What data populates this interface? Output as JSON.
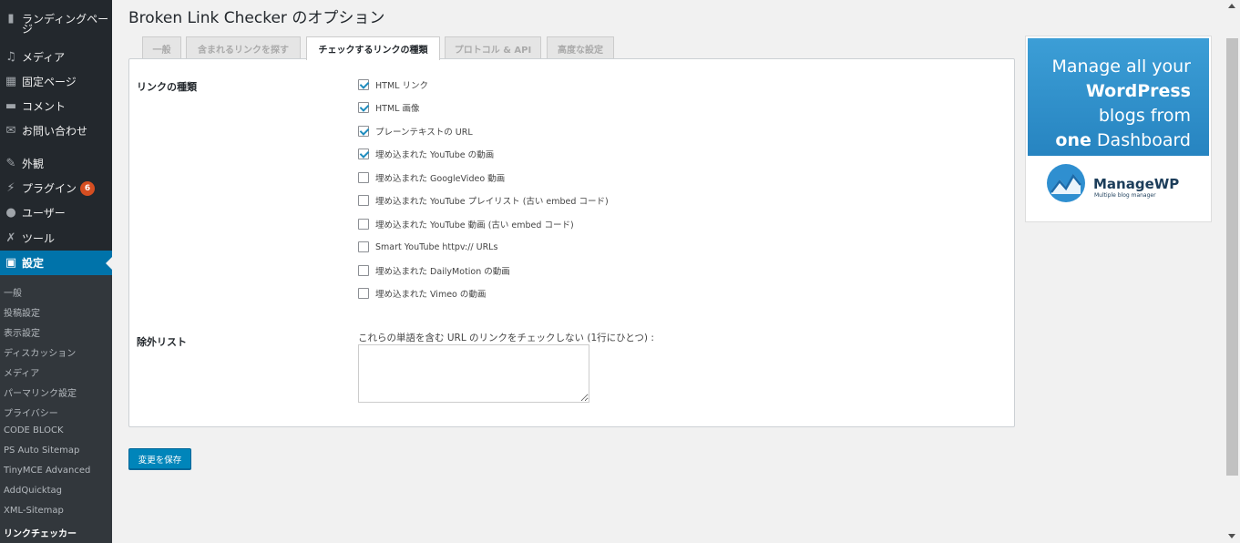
{
  "sidebar": {
    "items": [
      {
        "icon": "pages-icon",
        "glyph": "▮",
        "label": "ランディングペー"
      },
      {
        "icon": "media-icon",
        "glyph": "♫",
        "label": "メディア"
      },
      {
        "icon": "page-icon",
        "glyph": "▦",
        "label": "固定ページ"
      },
      {
        "icon": "comment-icon",
        "glyph": "▬",
        "label": "コメント"
      },
      {
        "icon": "mail-icon",
        "glyph": "✉",
        "label": "お問い合わせ"
      },
      {
        "icon": "appearance-icon",
        "glyph": "✎",
        "label": "外観"
      },
      {
        "icon": "plugin-icon",
        "glyph": "⚡",
        "label": "プラグイン",
        "badge": "6"
      },
      {
        "icon": "user-icon",
        "glyph": "●",
        "label": "ユーザー"
      },
      {
        "icon": "tools-icon",
        "glyph": "✗",
        "label": "ツール"
      },
      {
        "icon": "settings-icon",
        "glyph": "▣",
        "label": "設定"
      }
    ],
    "label_continuation": "ジ",
    "submenu": [
      "一般",
      "投稿設定",
      "表示設定",
      "ディスカッション",
      "メディア",
      "パーマリンク設定",
      "プライバシー",
      "CODE BLOCK",
      "PS Auto Sitemap",
      "TinyMCE Advanced",
      "AddQuicktag",
      "XML-Sitemap",
      "リンクチェッカー"
    ]
  },
  "page": {
    "title": "Broken Link Checker のオプション"
  },
  "tabs": [
    "一般",
    "含まれるリンクを探す",
    "チェックするリンクの種類",
    "プロトコル & API",
    "高度な設定"
  ],
  "link_types": {
    "label": "リンクの種類",
    "options": [
      {
        "label": "HTML リンク",
        "checked": true
      },
      {
        "label": "HTML 画像",
        "checked": true
      },
      {
        "label": "プレーンテキストの URL",
        "checked": true
      },
      {
        "label": "埋め込まれた YouTube の動画",
        "checked": true
      },
      {
        "label": "埋め込まれた GoogleVideo 動画",
        "checked": false
      },
      {
        "label": "埋め込まれた YouTube プレイリスト (古い embed コード)",
        "checked": false
      },
      {
        "label": "埋め込まれた YouTube 動画 (古い embed コード)",
        "checked": false
      },
      {
        "label": "Smart YouTube httpv:// URLs",
        "checked": false
      },
      {
        "label": "埋め込まれた DailyMotion の動画",
        "checked": false
      },
      {
        "label": "埋め込まれた Vimeo の動画",
        "checked": false
      }
    ]
  },
  "exclusion": {
    "label": "除外リスト",
    "description": "これらの単語を含む URL のリンクをチェックしない (1行にひとつ) :",
    "value": ""
  },
  "save_label": "変更を保存",
  "ad": {
    "line1": "Manage all your",
    "line2": "WordPress",
    "line3": "blogs from",
    "line4_bold": "one",
    "line4_rest": " Dashboard",
    "brand": "ManageWP",
    "tagline": "Multiple blog manager",
    "logo_icon": "managewp-logo-icon"
  },
  "colors": {
    "sidebar_bg": "#23282d",
    "accent": "#0073aa",
    "button": "#0085ba",
    "badge": "#d54e21",
    "checkmark": "#1e8cbe"
  }
}
